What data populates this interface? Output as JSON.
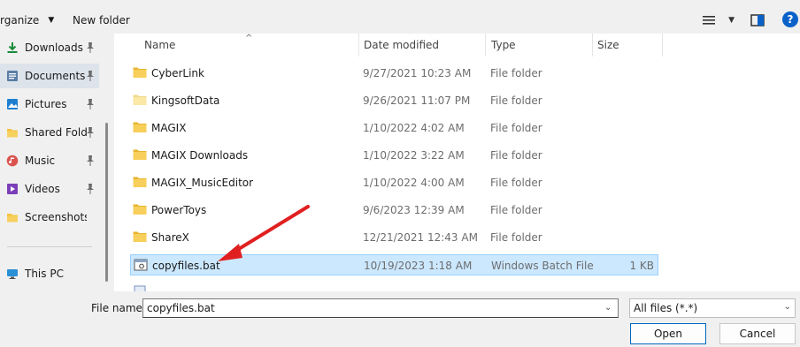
{
  "toolbar": {
    "organize_label": "rganize",
    "organize_caret": "▼",
    "new_folder_label": "New folder",
    "view_caret": "▼",
    "help_label": "?"
  },
  "sidebar": {
    "items": [
      {
        "label": "Downloads",
        "icon": "download-icon",
        "pinned": true
      },
      {
        "label": "Documents",
        "icon": "documents-icon",
        "pinned": true,
        "selected": true
      },
      {
        "label": "Pictures",
        "icon": "pictures-icon",
        "pinned": true
      },
      {
        "label": "Shared Folde",
        "icon": "folder-icon",
        "pinned": true
      },
      {
        "label": "Music",
        "icon": "music-icon",
        "pinned": true
      },
      {
        "label": "Videos",
        "icon": "videos-icon",
        "pinned": true
      },
      {
        "label": "Screenshots",
        "icon": "folder-icon",
        "pinned": false
      }
    ],
    "this_pc_label": "This PC"
  },
  "filelist": {
    "columns": {
      "name": "Name",
      "date": "Date modified",
      "type": "Type",
      "size": "Size"
    },
    "rows": [
      {
        "name": "CyberLink",
        "date": "9/27/2021 10:23 AM",
        "type": "File folder",
        "size": ""
      },
      {
        "name": "KingsoftData",
        "date": "9/26/2021 11:07 PM",
        "type": "File folder",
        "size": ""
      },
      {
        "name": "MAGIX",
        "date": "1/10/2022 4:02 AM",
        "type": "File folder",
        "size": ""
      },
      {
        "name": "MAGIX Downloads",
        "date": "1/10/2022 3:22 AM",
        "type": "File folder",
        "size": ""
      },
      {
        "name": "MAGIX_MusicEditor",
        "date": "1/10/2022 4:00 AM",
        "type": "File folder",
        "size": ""
      },
      {
        "name": "PowerToys",
        "date": "9/6/2023 12:39 AM",
        "type": "File folder",
        "size": ""
      },
      {
        "name": "ShareX",
        "date": "12/21/2021 12:43 AM",
        "type": "File folder",
        "size": ""
      },
      {
        "name": "copyfiles.bat",
        "date": "10/19/2023 1:18 AM",
        "type": "Windows Batch File",
        "size": "1 KB",
        "selected": true
      }
    ]
  },
  "bottom": {
    "file_name_label": "File name:",
    "file_name_value": "copyfiles.bat",
    "filter_value": "All files (*.*)",
    "open_label": "Open",
    "cancel_label": "Cancel"
  },
  "colors": {
    "accent": "#0067c0",
    "selection": "#cce8ff",
    "folder": "#f4c23d",
    "arrow": "#e02020"
  }
}
